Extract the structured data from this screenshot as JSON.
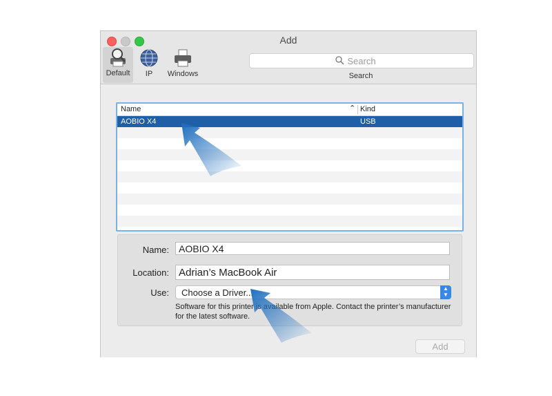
{
  "window": {
    "title": "Add"
  },
  "toolbar": {
    "items": [
      {
        "label": "Default",
        "icon": "magnifier-printer-icon",
        "selected": true
      },
      {
        "label": "IP",
        "icon": "globe-icon"
      },
      {
        "label": "Windows",
        "icon": "printer-icon"
      }
    ],
    "search": {
      "placeholder": "Search",
      "label": "Search"
    }
  },
  "printer_list": {
    "columns": {
      "name": "Name",
      "kind": "Kind"
    },
    "rows": [
      {
        "name": "AOBIO X4",
        "kind": "USB",
        "selected": true
      }
    ]
  },
  "form": {
    "name_label": "Name:",
    "name_value": "AOBIO X4",
    "location_label": "Location:",
    "location_value": "Adrian’s MacBook Air",
    "use_label": "Use:",
    "use_value": "Choose a Driver...",
    "note": "Software for this printer is available from Apple. Contact the printer’s manufacturer for the latest software."
  },
  "buttons": {
    "add": "Add"
  },
  "colors": {
    "selection": "#1f5fa8",
    "arrow": "#1f6fbf",
    "list_focus": "#7ab0e6"
  }
}
